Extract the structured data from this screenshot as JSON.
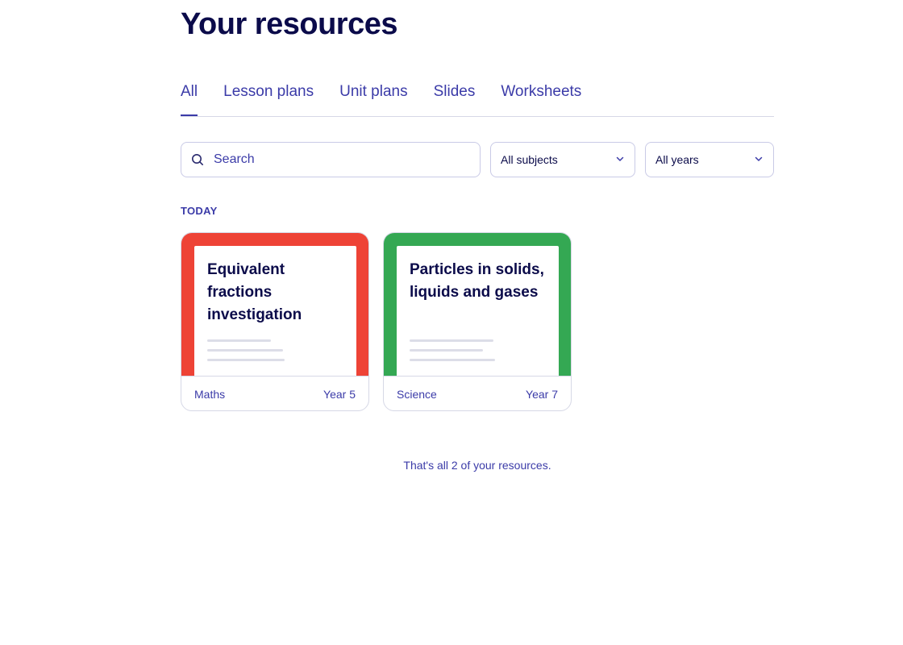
{
  "page": {
    "title": "Your resources"
  },
  "tabs": [
    {
      "label": "All",
      "active": true
    },
    {
      "label": "Lesson plans",
      "active": false
    },
    {
      "label": "Unit plans",
      "active": false
    },
    {
      "label": "Slides",
      "active": false
    },
    {
      "label": "Worksheets",
      "active": false
    }
  ],
  "filters": {
    "search": {
      "placeholder": "Search",
      "value": "",
      "icon": "search-icon"
    },
    "subjects": {
      "selected": "All subjects",
      "icon": "chevron-down-icon"
    },
    "years": {
      "selected": "All years",
      "icon": "chevron-down-icon"
    }
  },
  "sections": [
    {
      "label": "TODAY",
      "cards": [
        {
          "title": "Equivalent fractions investigation",
          "subject": "Maths",
          "year": "Year 5",
          "cover_color": "#ee4336"
        },
        {
          "title": "Particles in solids, liquids and gases",
          "subject": "Science",
          "year": "Year 7",
          "cover_color": "#34a853"
        }
      ]
    }
  ],
  "footer": {
    "message": "That's all 2 of your resources."
  },
  "colors": {
    "heading": "#0b0b4a",
    "accent": "#3b3ba8",
    "border": "#d6d8e6"
  }
}
